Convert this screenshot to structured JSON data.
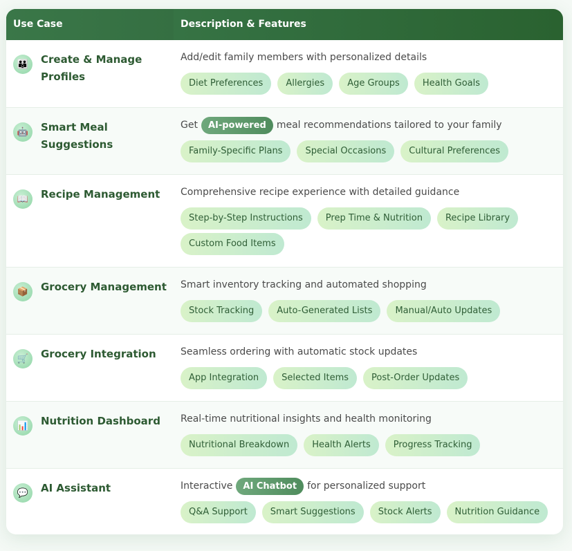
{
  "header": {
    "col1": "Use Case",
    "col2": "Description & Features"
  },
  "rows": [
    {
      "icon": "family-icon",
      "glyph": "👪",
      "title": "Create & Manage Profiles",
      "desc_before": "Add/edit family members with personalized details",
      "highlight": "",
      "desc_after": "",
      "tags": [
        "Diet Preferences",
        "Allergies",
        "Age Groups",
        "Health Goals"
      ]
    },
    {
      "icon": "robot-icon",
      "glyph": "🤖",
      "title": "Smart Meal Suggestions",
      "desc_before": "Get",
      "highlight": "AI-powered",
      "desc_after": "meal recommendations tailored to your family",
      "tags": [
        "Family-Specific Plans",
        "Special Occasions",
        "Cultural Preferences"
      ]
    },
    {
      "icon": "book-icon",
      "glyph": "📖",
      "title": "Recipe Management",
      "desc_before": "Comprehensive recipe experience with detailed guidance",
      "highlight": "",
      "desc_after": "",
      "tags": [
        "Step-by-Step Instructions",
        "Prep Time & Nutrition",
        "Recipe Library",
        "Custom Food Items"
      ]
    },
    {
      "icon": "package-icon",
      "glyph": "📦",
      "title": "Grocery Management",
      "desc_before": "Smart inventory tracking and automated shopping",
      "highlight": "",
      "desc_after": "",
      "tags": [
        "Stock Tracking",
        "Auto-Generated Lists",
        "Manual/Auto Updates"
      ]
    },
    {
      "icon": "cart-icon",
      "glyph": "🛒",
      "title": "Grocery Integration",
      "desc_before": "Seamless ordering with automatic stock updates",
      "highlight": "",
      "desc_after": "",
      "tags": [
        "App Integration",
        "Selected Items",
        "Post-Order Updates"
      ]
    },
    {
      "icon": "bar-chart-icon",
      "glyph": "📊",
      "title": "Nutrition Dashboard",
      "desc_before": "Real-time nutritional insights and health monitoring",
      "highlight": "",
      "desc_after": "",
      "tags": [
        "Nutritional Breakdown",
        "Health Alerts",
        "Progress Tracking"
      ]
    },
    {
      "icon": "chat-bubble-icon",
      "glyph": "💬",
      "title": "AI Assistant",
      "desc_before": "Interactive",
      "highlight": "AI Chatbot",
      "desc_after": "for personalized support",
      "tags": [
        "Q&A Support",
        "Smart Suggestions",
        "Stock Alerts",
        "Nutrition Guidance"
      ]
    }
  ]
}
